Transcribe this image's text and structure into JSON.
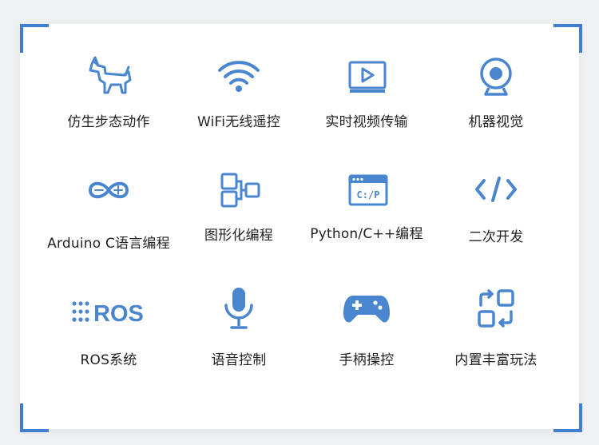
{
  "colors": {
    "accent": "#4a86cf"
  },
  "features": [
    {
      "label": "仿生步态动作",
      "icon": "robot-dog-icon"
    },
    {
      "label": "WiFi无线遥控",
      "icon": "wifi-icon"
    },
    {
      "label": "实时视频传输",
      "icon": "video-play-icon"
    },
    {
      "label": "机器视觉",
      "icon": "webcam-icon"
    },
    {
      "label": "Arduino C语言编程",
      "icon": "arduino-icon"
    },
    {
      "label": "图形化编程",
      "icon": "block-diagram-icon"
    },
    {
      "label": "Python/C++编程",
      "icon": "code-window-icon",
      "icon_text": "C:/P"
    },
    {
      "label": "二次开发",
      "icon": "code-brackets-icon"
    },
    {
      "label": "ROS系统",
      "icon": "ros-logo-icon",
      "icon_text": "ROS"
    },
    {
      "label": "语音控制",
      "icon": "microphone-icon"
    },
    {
      "label": "手柄操控",
      "icon": "gamepad-icon"
    },
    {
      "label": "内置丰富玩法",
      "icon": "switch-apps-icon"
    }
  ]
}
